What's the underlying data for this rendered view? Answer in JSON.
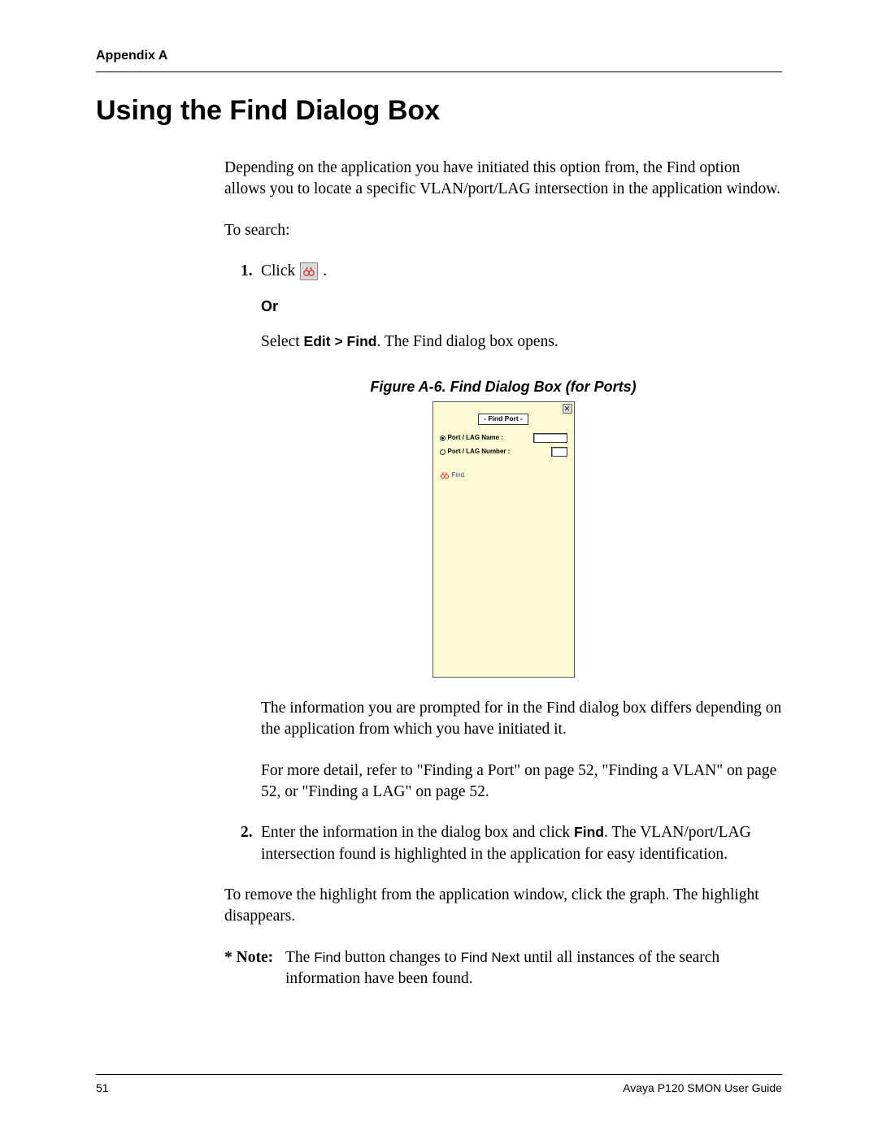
{
  "header": {
    "appendix": "Appendix A"
  },
  "title": "Using the Find Dialog Box",
  "intro": "Depending on the application you have initiated this option from, the Find option allows you to locate a specific VLAN/port/LAG intersection in the application window.",
  "to_search": "To search:",
  "step1": {
    "num": "1.",
    "click": "Click",
    "period": ".",
    "or": "Or",
    "select_prefix": "Select ",
    "menu_path": "Edit > Find",
    "select_suffix": ". The Find dialog box opens."
  },
  "figure": {
    "caption": "Figure A-6.  Find Dialog Box (for Ports)",
    "dialog": {
      "title": "- Find Port -",
      "row_name": "Port / LAG  Name :",
      "row_number": "Port / LAG  Number :",
      "find_label": "Find",
      "close": "✕"
    }
  },
  "after1": {
    "p1": "The information you are prompted for in the Find dialog box differs depending on the application from which you have initiated it.",
    "p2": "For more detail, refer to \"Finding a Port\" on page 52, \"Finding a VLAN\" on page 52, or \"Finding a LAG\" on page 52."
  },
  "step2": {
    "num": "2.",
    "prefix": "Enter the information in the dialog box and click ",
    "find": "Find",
    "suffix": ". The VLAN/port/LAG intersection found is highlighted in the application for easy identification."
  },
  "remove": "To remove the highlight from the application window, click the graph. The highlight disappears.",
  "note": {
    "label": "* Note:",
    "prefix": "The ",
    "find1": "Find",
    "mid": " button changes to ",
    "find2": "Find Next",
    "suffix": " until all instances of the search information have been found."
  },
  "footer": {
    "page": "51",
    "doc": "Avaya P120 SMON User Guide"
  }
}
